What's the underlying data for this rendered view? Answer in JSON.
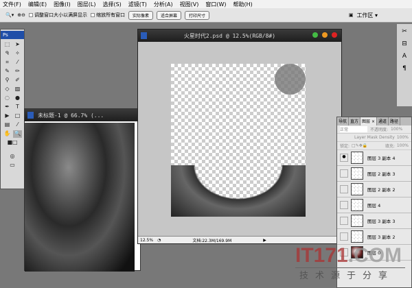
{
  "menu": [
    "文件(F)",
    "编辑(E)",
    "图像(I)",
    "图层(L)",
    "选择(S)",
    "滤镜(T)",
    "分析(A)",
    "视图(V)",
    "窗口(W)",
    "帮助(H)"
  ],
  "options": {
    "resize_label": "调整窗口大小以满屏显示",
    "zoom_all_label": "缩放所有窗口",
    "actual_pixels": "实际像素",
    "fit_screen": "适合屏幕",
    "print_size": "打印尺寸",
    "workspace": "工作区 ▾"
  },
  "toolbox": {
    "title": "Ps"
  },
  "small_window": {
    "title": "未标题-1 @ 66.7% (..."
  },
  "big_window": {
    "title": "火星时代2.psd @ 12.5%(RGB/8#)",
    "zoom": "12.5%",
    "doc_info": "文档:22.3M/169.9M"
  },
  "layers_panel": {
    "tabs": [
      "导航",
      "直方",
      "图层 ×",
      "通道",
      "路径"
    ],
    "blend_mode": "正常",
    "opacity_label": "不透明度:",
    "opacity": "100%",
    "mask_density_label": "Layer Mask Density",
    "mask_density": "100%",
    "lock_label": "锁定:",
    "fill_label": "填充:",
    "fill": "100%",
    "layers": [
      {
        "name": "图层 3 副本 4",
        "visible": true
      },
      {
        "name": "图层 2 副本 3",
        "visible": false
      },
      {
        "name": "图层 2 副本 2",
        "visible": false
      },
      {
        "name": "图层 4",
        "visible": false
      },
      {
        "name": "图层 3 副本 3",
        "visible": false
      },
      {
        "name": "图层 3 副本 2",
        "visible": false
      },
      {
        "name": "图层 0",
        "visible": false
      }
    ]
  },
  "watermark": {
    "logo": "IT171.COM",
    "slogan": "技术源于分享"
  }
}
